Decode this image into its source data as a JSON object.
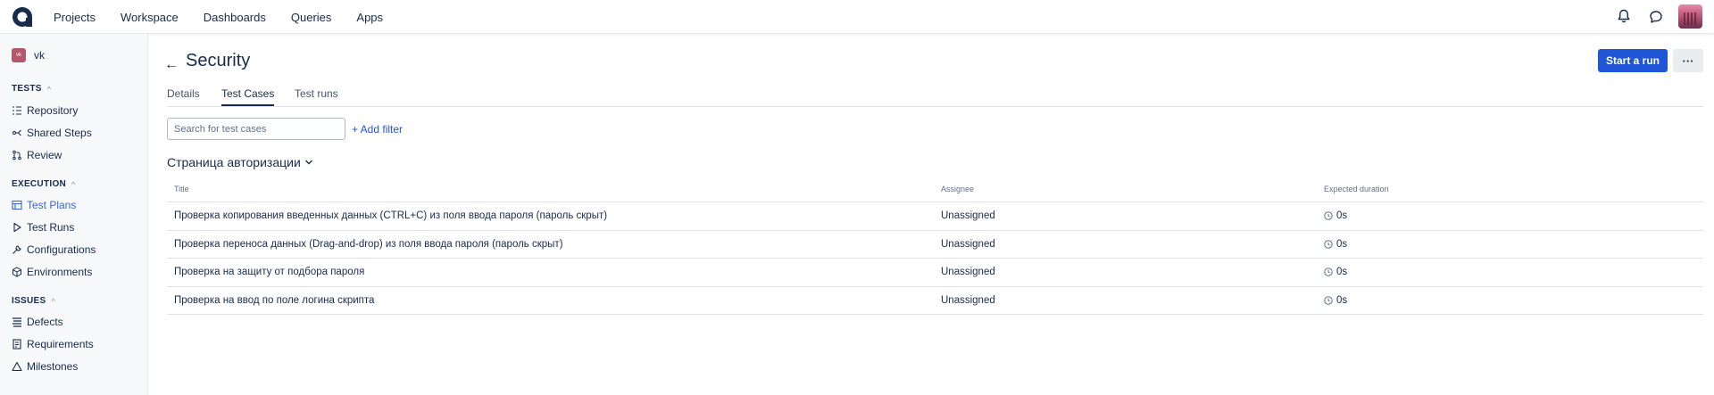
{
  "topnav": {
    "items": [
      "Projects",
      "Workspace",
      "Dashboards",
      "Queries",
      "Apps"
    ]
  },
  "sidebar": {
    "project": {
      "avatar_text": "vk",
      "name": "vk"
    },
    "sections": [
      {
        "title": "TESTS",
        "items": [
          {
            "label": "Repository",
            "icon": "repository-icon"
          },
          {
            "label": "Shared Steps",
            "icon": "shared-steps-icon"
          },
          {
            "label": "Review",
            "icon": "review-icon"
          }
        ]
      },
      {
        "title": "EXECUTION",
        "items": [
          {
            "label": "Test Plans",
            "icon": "test-plans-icon",
            "active": true
          },
          {
            "label": "Test Runs",
            "icon": "play-icon"
          },
          {
            "label": "Configurations",
            "icon": "wrench-icon"
          },
          {
            "label": "Environments",
            "icon": "cube-icon"
          }
        ]
      },
      {
        "title": "ISSUES",
        "items": [
          {
            "label": "Defects",
            "icon": "defects-icon"
          },
          {
            "label": "Requirements",
            "icon": "requirements-icon"
          },
          {
            "label": "Milestones",
            "icon": "milestone-icon"
          }
        ]
      }
    ]
  },
  "header": {
    "title": "Security",
    "start_run_label": "Start a run",
    "more_label": "···"
  },
  "tabs": [
    {
      "label": "Details",
      "active": false
    },
    {
      "label": "Test Cases",
      "active": true
    },
    {
      "label": "Test runs",
      "active": false
    }
  ],
  "search": {
    "placeholder": "Search for test cases",
    "value": ""
  },
  "add_filter_label": "+ Add filter",
  "group": {
    "title": "Страница авторизации"
  },
  "table": {
    "columns": [
      "Title",
      "Assignee",
      "Expected duration"
    ],
    "rows": [
      {
        "title": "Проверка копирования введенных данных (CTRL+C) из поля ввода пароля (пароль скрыт)",
        "assignee": "Unassigned",
        "duration": "0s"
      },
      {
        "title": "Проверка переноса данных (Drag-and-drop) из поля ввода пароля (пароль скрыт)",
        "assignee": "Unassigned",
        "duration": "0s"
      },
      {
        "title": "Проверка на защиту от подбора пароля",
        "assignee": "Unassigned",
        "duration": "0s"
      },
      {
        "title": "Проверка на ввод по поле логина скрипта",
        "assignee": "Unassigned",
        "duration": "0s"
      }
    ]
  },
  "colors": {
    "accent": "#1f55d6",
    "active_nav": "#3768d8",
    "text": "#172b4d",
    "sidebar_bg": "#f7f8f9"
  }
}
